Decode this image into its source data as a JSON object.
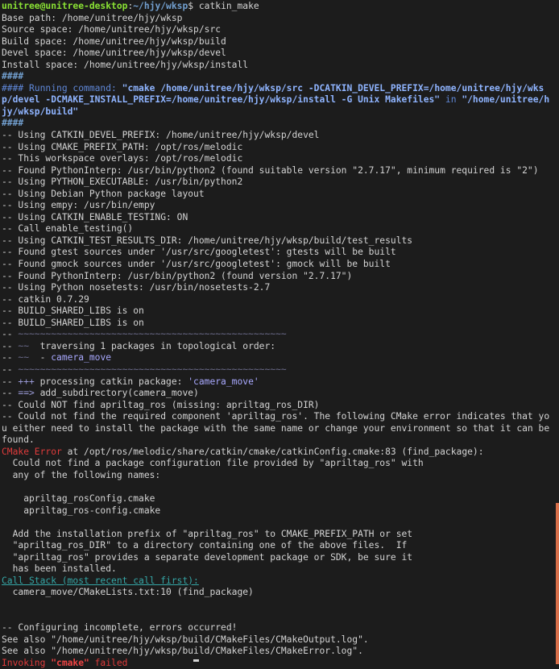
{
  "prompt": {
    "user_host": "unitree@unitree-desktop",
    "sep": ":",
    "path": "~/hjy/wksp",
    "dollar": "$",
    "command": " catkin_make"
  },
  "paths": {
    "base": "Base path: /home/unitree/hjy/wksp",
    "source": "Source space: /home/unitree/hjy/wksp/src",
    "build": "Build space: /home/unitree/hjy/wksp/build",
    "devel": "Devel space: /home/unitree/hjy/wksp/devel",
    "install": "Install space: /home/unitree/hjy/wksp/install"
  },
  "hashes": "####",
  "running": {
    "prefix": "#### Running command: ",
    "cmd": "\"cmake /home/unitree/hjy/wksp/src -DCATKIN_DEVEL_PREFIX=/home/unitree/hjy/wksp/devel -DCMAKE_INSTALL_PREFIX=/home/unitree/hjy/wksp/install -G Unix Makefiles\"",
    "in": " in ",
    "dir": "\"/home/unitree/hjy/wksp/build\""
  },
  "log": [
    "-- Using CATKIN_DEVEL_PREFIX: /home/unitree/hjy/wksp/devel",
    "-- Using CMAKE_PREFIX_PATH: /opt/ros/melodic",
    "-- This workspace overlays: /opt/ros/melodic",
    "-- Found PythonInterp: /usr/bin/python2 (found suitable version \"2.7.17\", minimum required is \"2\")",
    "-- Using PYTHON_EXECUTABLE: /usr/bin/python2",
    "-- Using Debian Python package layout",
    "-- Using empy: /usr/bin/empy",
    "-- Using CATKIN_ENABLE_TESTING: ON",
    "-- Call enable_testing()",
    "-- Using CATKIN_TEST_RESULTS_DIR: /home/unitree/hjy/wksp/build/test_results",
    "-- Found gtest sources under '/usr/src/googletest': gtests will be built",
    "-- Found gmock sources under '/usr/src/googletest': gmock will be built",
    "-- Found PythonInterp: /usr/bin/python2 (found version \"2.7.17\")",
    "-- Using Python nosetests: /usr/bin/nosetests-2.7",
    "-- catkin 0.7.29",
    "-- BUILD_SHARED_LIBS is on",
    "-- BUILD_SHARED_LIBS is on"
  ],
  "topo": {
    "dash": "-- ",
    "tilde_line": "~~~~~~~~~~~~~~~~~~~~~~~~~~~~~~~~~~~~~~~~~~~~~~~~~",
    "t1_tilde": "~~",
    "t1_text": "  traversing 1 packages in topological order:",
    "t2_tilde": "~~",
    "t2_text": "  - ",
    "t2_pkg": "camera_move"
  },
  "proc": {
    "dash": "-- ",
    "plus": "+++",
    "text": " processing catkin package: ",
    "pkg": "'camera_move'",
    "arrow": "==>",
    "add": " add_subdirectory(camera_move)"
  },
  "notfound": [
    "-- Could NOT find apriltag_ros (missing: apriltag_ros_DIR)",
    "-- Could not find the required component 'apriltag_ros'. The following CMake error indicates that you either need to install the package with the same name or change your environment so that it can be found."
  ],
  "cmake_error": {
    "label": "CMake Error",
    "rest": " at /opt/ros/melodic/share/catkin/cmake/catkinConfig.cmake:83 (find_package):"
  },
  "error_body": [
    "  Could not find a package configuration file provided by \"apriltag_ros\" with",
    "  any of the following names:",
    "",
    "    apriltag_rosConfig.cmake",
    "    apriltag_ros-config.cmake",
    "",
    "  Add the installation prefix of \"apriltag_ros\" to CMAKE_PREFIX_PATH or set",
    "  \"apriltag_ros_DIR\" to a directory containing one of the above files.  If",
    "  \"apriltag_ros\" provides a separate development package or SDK, be sure it",
    "  has been installed."
  ],
  "callstack": {
    "label": "Call Stack (most recent call first):",
    "item": "  camera_move/CMakeLists.txt:10 (find_package)"
  },
  "ending": [
    "",
    "",
    "-- Configuring incomplete, errors occurred!",
    "See also \"/home/unitree/hjy/wksp/build/CMakeFiles/CMakeOutput.log\".",
    "See also \"/home/unitree/hjy/wksp/build/CMakeFiles/CMakeError.log\"."
  ],
  "invoking": {
    "pre": "Invoking ",
    "cmd": "\"cmake\"",
    "post": " failed"
  },
  "colors": {
    "background": "#1c1c1c",
    "text": "#d4d4d4",
    "prompt_user": "#8ae234",
    "prompt_path": "#729fcf",
    "error": "#e03b3b",
    "scrollbar": "#d9704a"
  }
}
